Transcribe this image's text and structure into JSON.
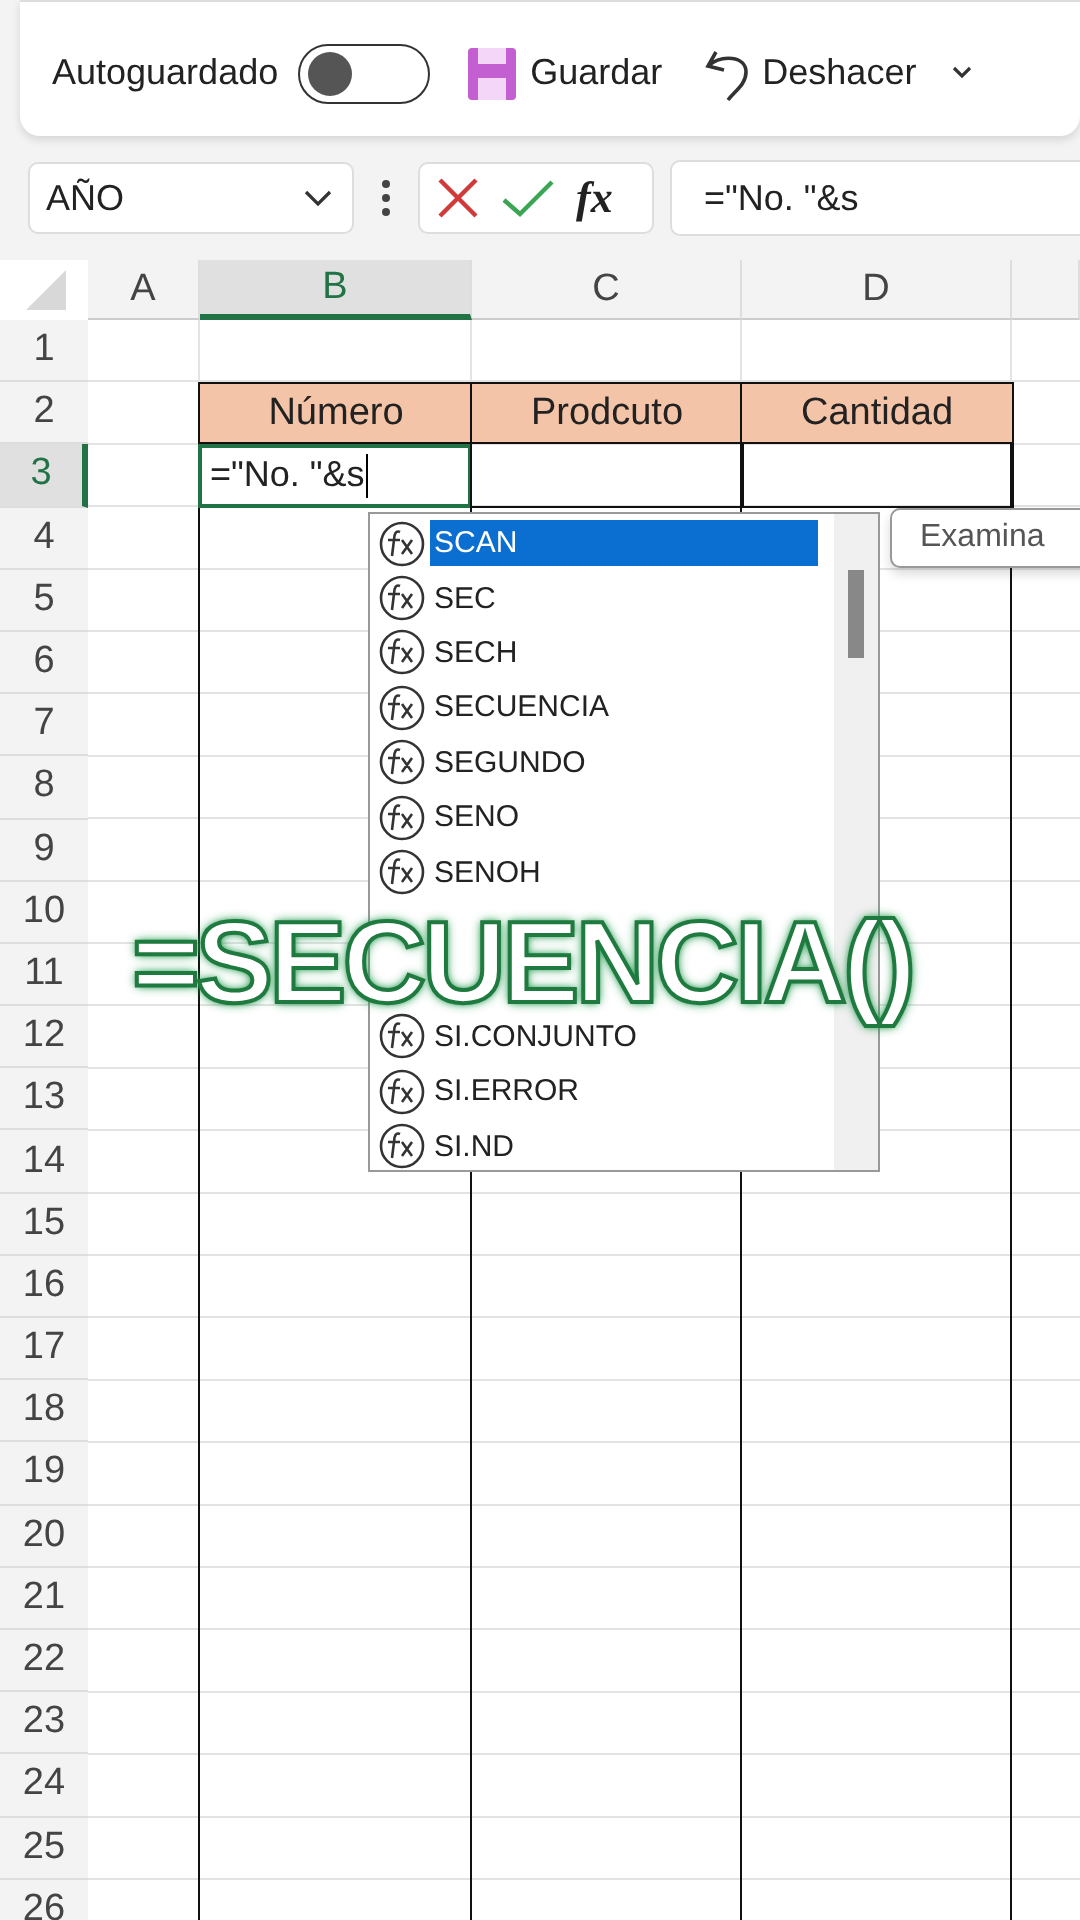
{
  "quick_access": {
    "autosave": {
      "label": "Autoguardado",
      "on": false
    },
    "buttons": [
      {
        "kind": "save",
        "label": "Guardar"
      },
      {
        "kind": "undo",
        "label": "Deshacer"
      }
    ]
  },
  "formula_bar": {
    "name_box": "AÑO",
    "function_button": "fx",
    "formula": "=\"No. \"&s"
  },
  "sheet": {
    "columns": [
      {
        "label": "A",
        "selected": false
      },
      {
        "label": "B",
        "selected": true
      },
      {
        "label": "C",
        "selected": false
      },
      {
        "label": "D",
        "selected": false
      }
    ],
    "rows": [
      {
        "label": "1",
        "selected": false
      },
      {
        "label": "2",
        "selected": false
      },
      {
        "label": "3",
        "selected": true
      },
      {
        "label": "4",
        "selected": false
      },
      {
        "label": "5",
        "selected": false
      },
      {
        "label": "6",
        "selected": false
      },
      {
        "label": "7",
        "selected": false
      },
      {
        "label": "8",
        "selected": false
      },
      {
        "label": "9",
        "selected": false
      },
      {
        "label": "10",
        "selected": false
      },
      {
        "label": "11",
        "selected": false
      },
      {
        "label": "12",
        "selected": false
      },
      {
        "label": "13",
        "selected": false
      },
      {
        "label": "14",
        "selected": false
      },
      {
        "label": "15",
        "selected": false
      },
      {
        "label": "16",
        "selected": false
      },
      {
        "label": "17",
        "selected": false
      },
      {
        "label": "18",
        "selected": false
      },
      {
        "label": "19",
        "selected": false
      },
      {
        "label": "20",
        "selected": false
      },
      {
        "label": "21",
        "selected": false
      },
      {
        "label": "22",
        "selected": false
      },
      {
        "label": "23",
        "selected": false
      },
      {
        "label": "24",
        "selected": false
      },
      {
        "label": "25",
        "selected": false
      },
      {
        "label": "26",
        "selected": false
      }
    ],
    "table_headers": [
      "Número",
      "Prodcuto",
      "Cantidad"
    ],
    "active_cell": "=\"No. \"&s"
  },
  "autocomplete": {
    "items_above": [
      {
        "label": "SCAN",
        "selected": true
      },
      {
        "label": "SEC",
        "selected": false
      },
      {
        "label": "SECH",
        "selected": false
      },
      {
        "label": "SECUENCIA",
        "selected": false
      },
      {
        "label": "SEGUNDO",
        "selected": false
      },
      {
        "label": "SENO",
        "selected": false
      },
      {
        "label": "SENOH",
        "selected": false
      }
    ],
    "items_below": [
      {
        "label": "SI.CONJUNTO",
        "selected": false
      },
      {
        "label": "SI.ERROR",
        "selected": false
      },
      {
        "label": "SI.ND",
        "selected": false
      }
    ]
  },
  "tooltip": "Examina",
  "caption": "=SECUENCIA()"
}
